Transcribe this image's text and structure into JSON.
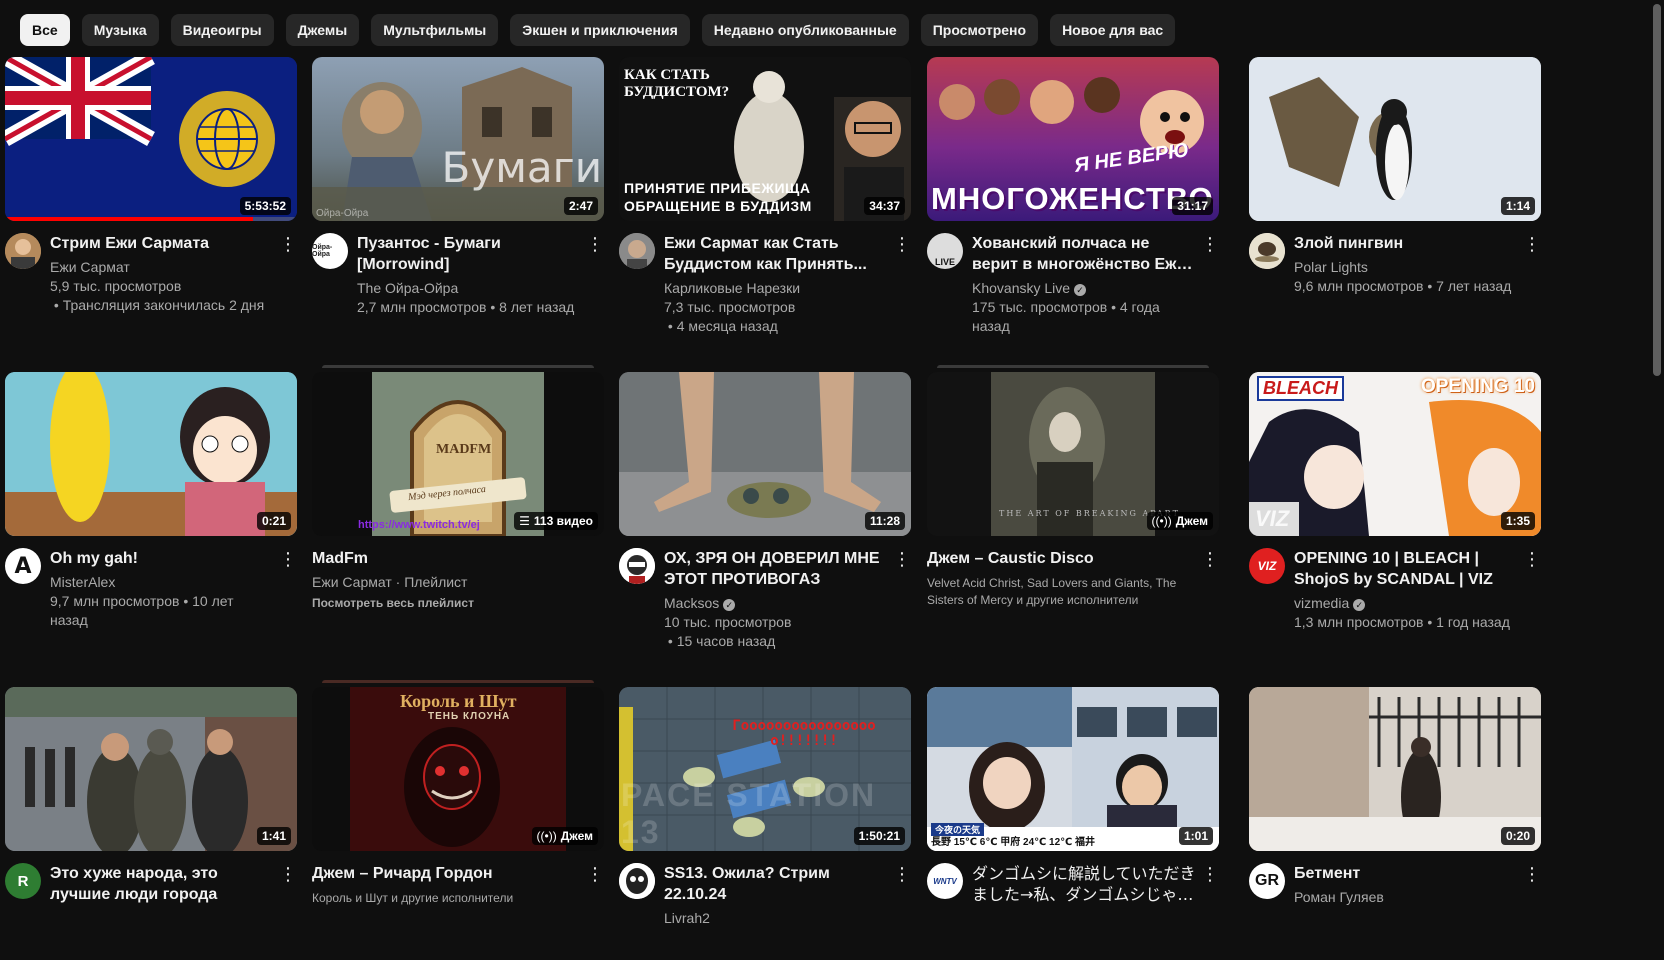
{
  "chips": [
    "Все",
    "Музыка",
    "Видеоигры",
    "Джемы",
    "Мультфильмы",
    "Экшен и приключения",
    "Недавно опубликованные",
    "Просмотрено",
    "Новое для вас"
  ],
  "videos": [
    {
      "title": "Стрим Ежи Сармата",
      "channel": "Ежи Сармат",
      "views": "5,9 тыс. просмотров",
      "age": "Трансляция закончилась 2 дня",
      "duration": "5:53:52",
      "progress": 0.85
    },
    {
      "title": "Пузантос - Бумаги [Morrowind]",
      "channel": "The Ойра-Ойра",
      "views": "2,7 млн просмотров",
      "age": "8 лет назад",
      "duration": "2:47",
      "thumb_text": "Бумаги",
      "thumb_small": "Ойра-Ойра",
      "avatar_text": "Ойра-Ойра"
    },
    {
      "title": "Ежи Сармат как Стать Буддистом как Принять...",
      "channel": "Карликовые Нарезки",
      "views": "7,3 тыс. просмотров",
      "age": "4 месяца назад",
      "duration": "34:37",
      "thumb_text_top": "КАК СТАТЬ БУДДИСТОМ?",
      "thumb_text_bottom": "ПРИНЯТИЕ ПРИБЕЖИЩА ОБРАЩЕНИЕ В БУДДИЗМ"
    },
    {
      "title": "Хованский полчаса не верит в многожёнство Ежи Сармата",
      "channel": "Khovansky Live",
      "verified": true,
      "views": "175 тыс. просмотров",
      "age": "4 года назад",
      "duration": "31:17",
      "thumb_text": "МНОГОЖЕНСТВО",
      "thumb_text2": "Я НЕ ВЕРЮ",
      "avatar_text": "LIVE"
    },
    {
      "title": "Злой пингвин",
      "channel": "Polar Lights",
      "views": "9,6 млн просмотров",
      "age": "7 лет назад",
      "duration": "1:14"
    },
    {
      "title": "Oh my gah!",
      "channel": "MisterAlex",
      "views": "9,7 млн просмотров",
      "age": "10 лет назад",
      "duration": "0:21",
      "avatar_text": "A"
    },
    {
      "title": "MadFm",
      "channel": "Ежи Сармат",
      "playlist_label": "Плейлист",
      "playlist_link": "Посмотреть весь плейлист",
      "badge": "113 видео",
      "thumb_text": "MADFM",
      "thumb_sub": "Мэд через полчаса",
      "thumb_link": "https://www.twitch.tv/ej"
    },
    {
      "title": "ОХ, ЗРЯ ОН ДОВЕРИЛ МНЕ ЭТОТ ПРОТИВОГАЗ",
      "channel": "Macksos",
      "verified": true,
      "views": "10 тыс. просмотров",
      "age": "15 часов назад",
      "duration": "11:28"
    },
    {
      "title": "Джем – Caustic Disco",
      "artists": "Velvet Acid Christ, Sad Lovers and Giants, The Sisters of Mercy и другие исполнители",
      "badge": "Джем",
      "thumb_text": "THE ART OF BREAKING APART"
    },
    {
      "title": "OPENING 10 | BLEACH | ShojoS by SCANDAL | VIZ",
      "channel": "vizmedia",
      "verified": true,
      "views": "1,3 млн просмотров",
      "age": "1 год назад",
      "duration": "1:35",
      "thumb_text": "OPENING 10",
      "thumb_logo": "BLEACH",
      "thumb_viz": "VIZ",
      "avatar_text": "VIZ"
    },
    {
      "title": "Это хуже народа, это лучшие люди города",
      "channel": "",
      "duration": "1:41",
      "avatar_text": "R"
    },
    {
      "title": "Джем – Ричард Гордон",
      "artists": "Король и Шут и другие исполнители",
      "badge": "Джем",
      "thumb_text": "Король и Шут",
      "thumb_sub": "ТЕНЬ КЛОУНА"
    },
    {
      "title": "SS13. Ожила? Стрим 22.10.24",
      "channel": "Livrah2",
      "duration": "1:50:21",
      "thumb_text": "Гоооооооооооооооо о!!!!!!!",
      "thumb_bg_text": "PACE STATION 13"
    },
    {
      "title": "ダンゴムシに解説していただきました→私、ダンゴムシじゃな...",
      "channel": "",
      "duration": "1:01",
      "thumb_text": "今夜の天気",
      "thumb_weather": "長野 15℃ 6℃  甲府 24℃ 12℃  福井",
      "avatar_text": "WNTV"
    },
    {
      "title": "Бетмент",
      "channel": "Роман Гуляев",
      "duration": "0:20",
      "avatar_text": "GR"
    }
  ],
  "colors": {
    "background": "#0f0f0f",
    "chip": "#272727",
    "progress": "#ff0000",
    "muted": "#aaaaaa"
  }
}
